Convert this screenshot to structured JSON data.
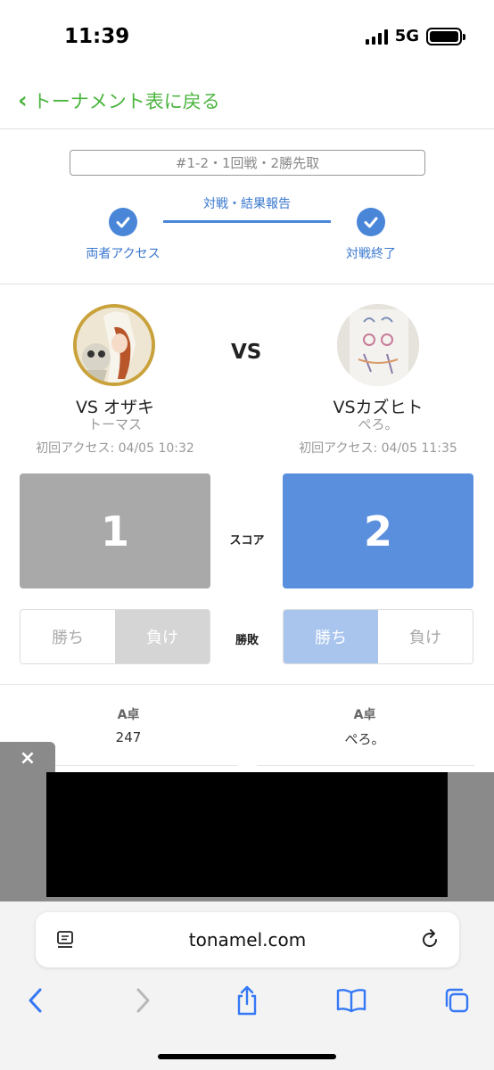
{
  "status": {
    "time": "11:39",
    "network": "5G"
  },
  "nav": {
    "back_label": "トーナメント表に戻る"
  },
  "match": {
    "info": "#1-2・1回戦・2勝先取"
  },
  "progress": {
    "step1": "両者アクセス",
    "middle": "対戦・結果報告",
    "step2": "対戦終了"
  },
  "vs_label": "VS",
  "players": [
    {
      "name": "VS オザキ",
      "sub": "トーマス",
      "access": "初回アクセス: 04/05 10:32",
      "score": "1",
      "result": "lose"
    },
    {
      "name": "VSカズヒト",
      "sub": "ぺろ。",
      "access": "初回アクセス: 04/05 11:35",
      "score": "2",
      "result": "win"
    }
  ],
  "labels": {
    "score": "スコア",
    "result": "勝敗",
    "win": "勝ち",
    "lose": "負け"
  },
  "tables": [
    {
      "label": "A卓",
      "value": "247"
    },
    {
      "label": "A卓",
      "value": "ぺろ。"
    }
  ],
  "ad": {
    "close_symbol": "×"
  },
  "browser": {
    "url": "tonamel.com"
  },
  "colors": {
    "accent_green": "#4cb53f",
    "accent_blue": "#4a86d8",
    "score_gray": "#a9a9a9",
    "score_blue": "#5a8fde"
  }
}
